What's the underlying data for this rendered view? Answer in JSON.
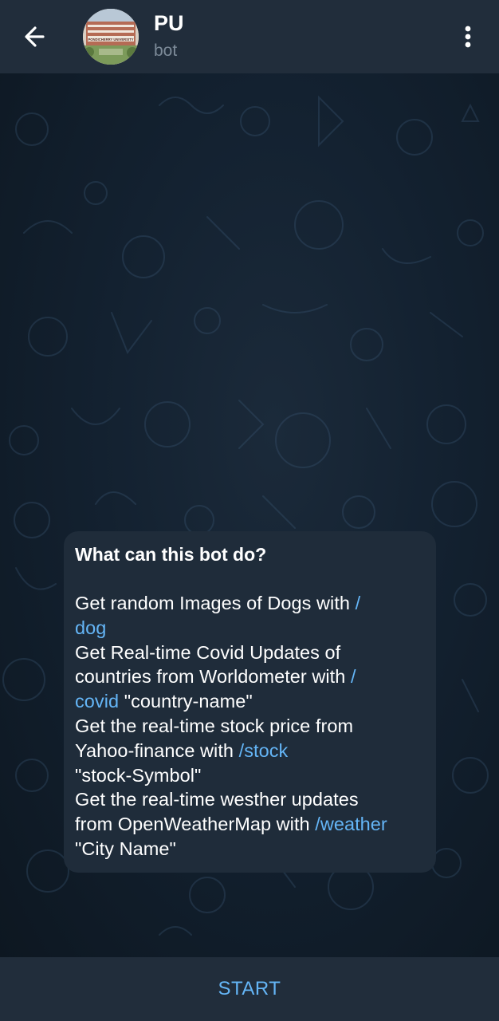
{
  "header": {
    "title": "PU",
    "subtitle": "bot",
    "back_icon": "arrow-left-icon",
    "menu_icon": "more-vertical-icon",
    "avatar_caption": "PONDICHERRY UNIVERSITY"
  },
  "info_card": {
    "heading": "What can this bot do?",
    "lines": [
      {
        "text": "Get random Images of Dogs with ",
        "cmd_a": "/",
        "cmd_b": "dog",
        "after": ""
      },
      {
        "text_a": "Get Real-time Covid Updates  of",
        "text_b": "countries from Worldometer with ",
        "cmd_a": "/",
        "cmd_b": "covid",
        "after": " \"country-name\""
      },
      {
        "text_a": "Get the real-time stock price from",
        "text_b": "Yahoo-finance with ",
        "cmd": "/stock",
        "after": "\"stock-Symbol\""
      },
      {
        "text_a": "Get the real-time westher updates",
        "text_b": "from OpenWeatherMap with ",
        "cmd": "/weather",
        "after": "\"City Name\""
      }
    ]
  },
  "footer": {
    "start_label": "START"
  },
  "colors": {
    "header_bg": "#212d3b",
    "bubble_bg": "#1f2c3a",
    "link": "#64b5f6"
  }
}
